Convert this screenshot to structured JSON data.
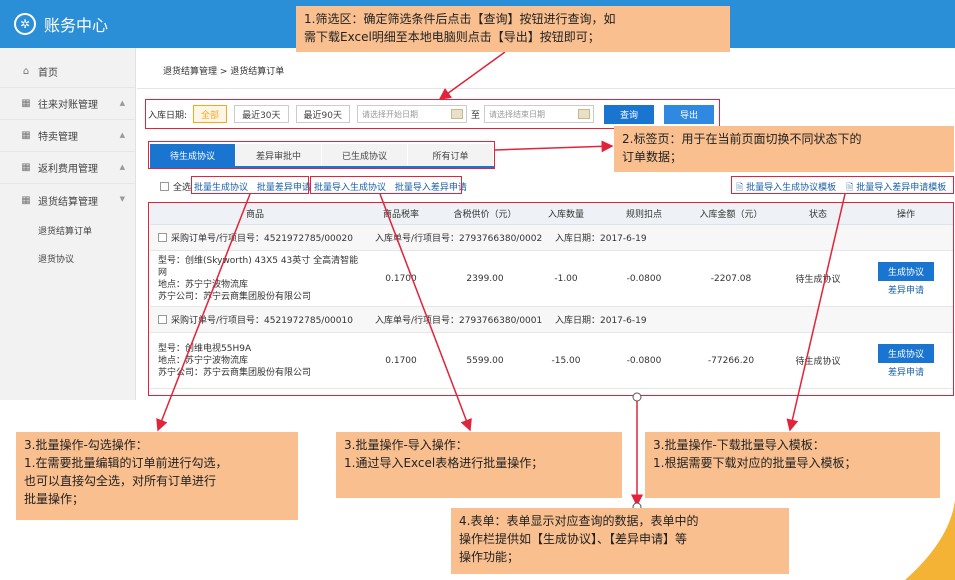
{
  "app": {
    "title": "账务中心"
  },
  "sidebar": {
    "items": [
      {
        "label": "首页",
        "icon": "home-icon"
      },
      {
        "label": "往来对账管理",
        "icon": "ledger-icon"
      },
      {
        "label": "特卖管理",
        "icon": "ledger-icon"
      },
      {
        "label": "返利费用管理",
        "icon": "ledger-icon"
      },
      {
        "label": "退货结算管理",
        "icon": "ledger-icon"
      }
    ],
    "subitems": [
      "退货结算订单",
      "退货协议"
    ]
  },
  "breadcrumb": "退货结算管理 > 退货结算订单",
  "filter": {
    "label": "入库日期:",
    "quick": [
      "全部",
      "最近30天",
      "最近90天"
    ],
    "start_placeholder": "请选择开始日期",
    "to": "至",
    "end_placeholder": "请选择结束日期",
    "query": "查询",
    "export": "导出"
  },
  "tabs": [
    "待生成协议",
    "差异审批中",
    "已生成协议",
    "所有订单"
  ],
  "batch": {
    "select_all": "全选",
    "gen_protocol": "批量生成协议",
    "diff_apply": "批量差异申请",
    "import_gen": "批量导入生成协议",
    "import_diff": "批量导入差异申请",
    "tpl_gen": "批量导入生成协议模板",
    "tpl_diff": "批量导入差异申请模板"
  },
  "table": {
    "headers": [
      "商品",
      "商品税率",
      "含税供价（元）",
      "入库数量",
      "规则扣点",
      "入库金额（元）",
      "状态",
      "操作"
    ],
    "orders": [
      {
        "po": "采购订单号/行项目号：4521972785/00020",
        "inbound": "入库单号/行项目号：2793766380/0002",
        "date": "入库日期：2017-6-19",
        "model": "型号：创维(Skyworth) 43X5 43英寸 全高清智能网",
        "site": "地点：苏宁宁波物流库",
        "company": "苏宁公司：苏宁云商集团股份有限公司",
        "tax": "0.1700",
        "price": "2399.00",
        "qty": "-1.00",
        "deduct": "-0.0800",
        "amount": "-2207.08",
        "status": "待生成协议",
        "gen": "生成协议",
        "diff": "差异申请"
      },
      {
        "po": "采购订单号/行项目号：4521972785/00010",
        "inbound": "入库单号/行项目号：2793766380/0001",
        "date": "入库日期：2017-6-19",
        "model": "型号：创维电视55H9A",
        "site": "地点：苏宁宁波物流库",
        "company": "苏宁公司：苏宁云商集团股份有限公司",
        "tax": "0.1700",
        "price": "5599.00",
        "qty": "-15.00",
        "deduct": "-0.0800",
        "amount": "-77266.20",
        "status": "待生成协议",
        "gen": "生成协议",
        "diff": "差异申请"
      }
    ]
  },
  "callouts": {
    "c1": [
      "1.筛选区：确定筛选条件后点击【查询】按钮进行查询，如",
      "需下载Excel明细至本地电脑则点击【导出】按钮即可；"
    ],
    "c2": [
      "2.标签页：用于在当前页面切换不同状态下的",
      "订单数据；"
    ],
    "c3": [
      "3.批量操作-勾选操作：",
      "1.在需要批量编辑的订单前进行勾选，",
      "也可以直接勾全选，对所有订单进行",
      "批量操作；"
    ],
    "c4": [
      "3.批量操作-导入操作：",
      "1.通过导入Excel表格进行批量操作；"
    ],
    "c5": [
      "3.批量操作-下载批量导入模板：",
      "1.根据需要下载对应的批量导入模板；"
    ],
    "c6": [
      "4.表单：表单显示对应查询的数据，表单中的",
      "操作栏提供如【生成协议】、【差异申请】等",
      "操作功能；"
    ]
  },
  "colors": {
    "primary": "#1a75d0",
    "topbar": "#2b8fd8",
    "annotation": "#e2233a",
    "callout": "#f9bf8f",
    "active_quick": "#f5a623"
  }
}
